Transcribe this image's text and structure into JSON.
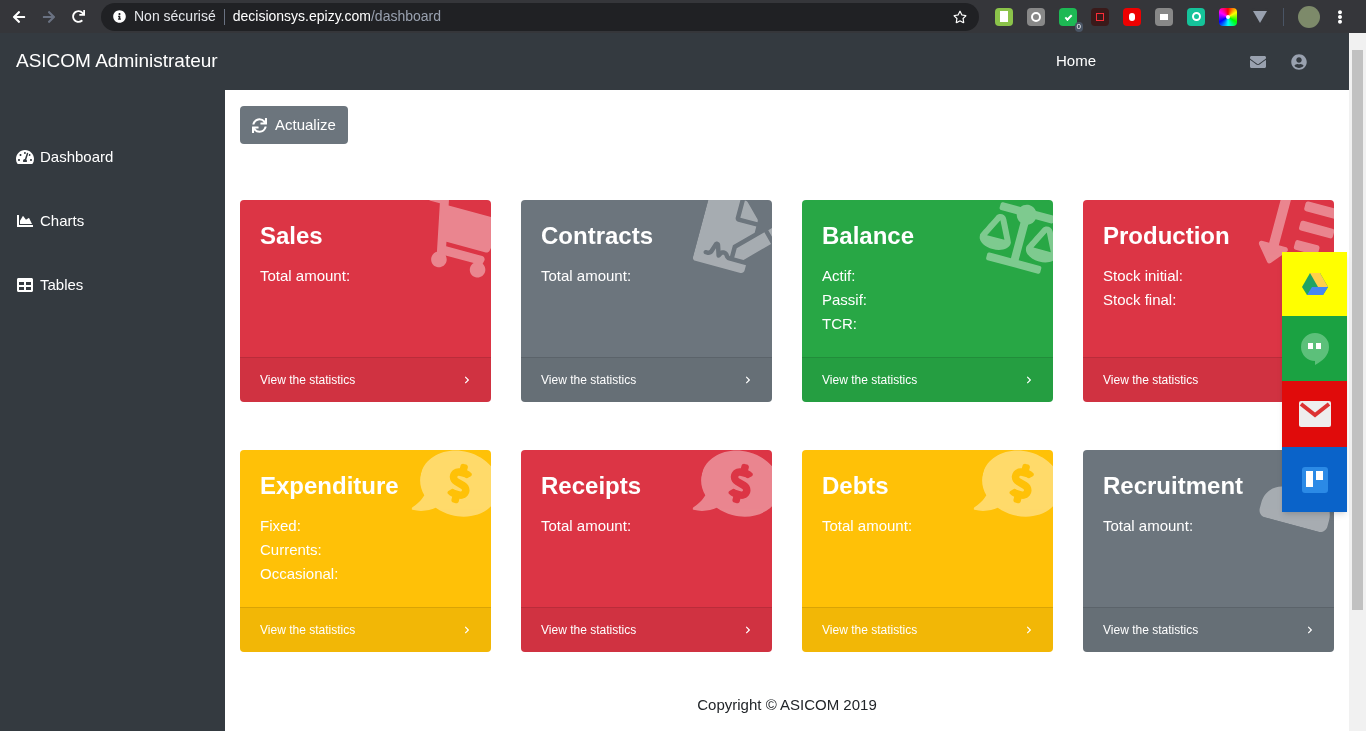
{
  "browser": {
    "security": "Non sécurisé",
    "url_host": "decisionsys.epizy.com",
    "url_path": "/dashboard",
    "extension_badge": "0"
  },
  "navbar": {
    "brand": "ASICOM Administrateur",
    "links": [
      {
        "label": "Home"
      }
    ]
  },
  "sidebar": {
    "items": [
      {
        "label": "Dashboard"
      },
      {
        "label": "Charts"
      },
      {
        "label": "Tables"
      }
    ]
  },
  "toolbar": {
    "button": "Actualize"
  },
  "cards": [
    {
      "title": "Sales",
      "color": "#dc3545",
      "kind": "cart",
      "lines": [
        "Total amount:"
      ],
      "link": "View the statistics"
    },
    {
      "title": "Contracts",
      "color": "#6c757d",
      "kind": "contract",
      "lines": [
        "Total amount:"
      ],
      "link": "View the statistics"
    },
    {
      "title": "Balance",
      "color": "#28a745",
      "kind": "scale",
      "lines": [
        "Actif:",
        "Passif:",
        "TCR:"
      ],
      "link": "View the statistics"
    },
    {
      "title": "Production",
      "color": "#dc3545",
      "kind": "production",
      "lines": [
        "Stock initial:",
        "Stock final:"
      ],
      "link": "View the statistics"
    },
    {
      "title": "Expenditure",
      "color": "#ffc107",
      "kind": "money",
      "lines": [
        "Fixed:",
        "Currents:",
        "Occasional:"
      ],
      "link": "View the statistics"
    },
    {
      "title": "Receipts",
      "color": "#dc3545",
      "kind": "money",
      "lines": [
        "Total amount:"
      ],
      "link": "View the statistics"
    },
    {
      "title": "Debts",
      "color": "#ffc107",
      "kind": "money",
      "lines": [
        "Total amount:"
      ],
      "link": "View the statistics"
    },
    {
      "title": "Recruitment",
      "color": "#6c757d",
      "kind": "user",
      "lines": [
        "Total amount:"
      ],
      "link": "View the statistics"
    }
  ],
  "footer": "Copyright © ASICOM 2019"
}
